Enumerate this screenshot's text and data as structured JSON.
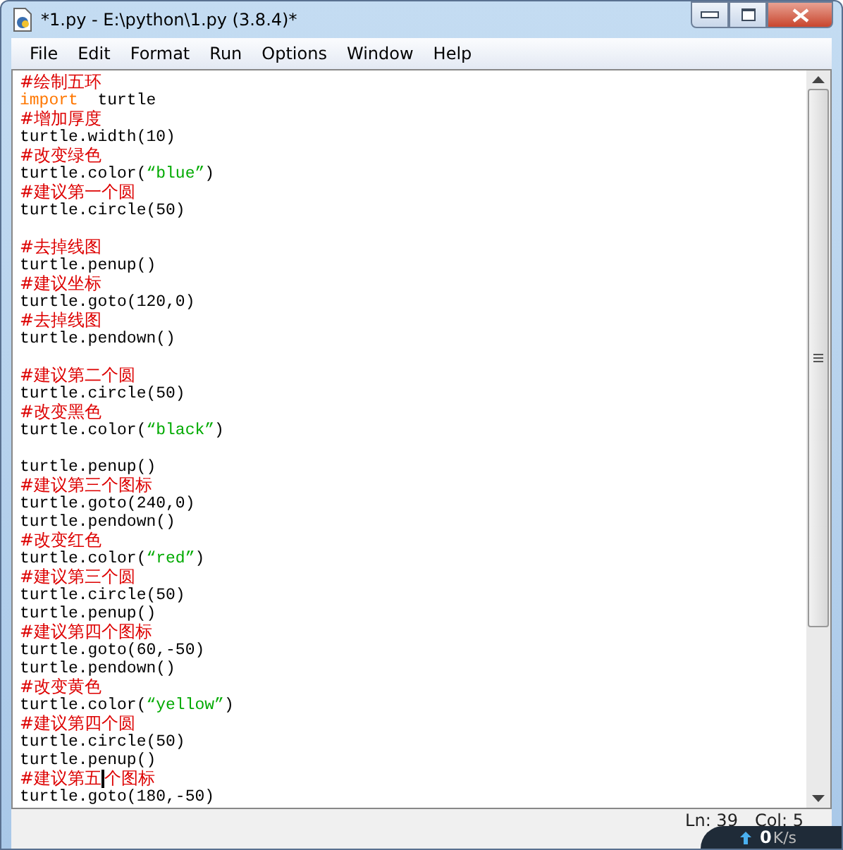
{
  "window": {
    "title": "*1.py - E:\\python\\1.py (3.8.4)*"
  },
  "menu": [
    "File",
    "Edit",
    "Format",
    "Run",
    "Options",
    "Window",
    "Help"
  ],
  "lines": [
    {
      "kind": "code",
      "tokens": [
        {
          "kind": "comment",
          "text": "#绘制五环"
        }
      ]
    },
    {
      "kind": "code",
      "tokens": [
        {
          "kind": "keyword",
          "text": "import"
        },
        {
          "kind": "plain",
          "text": "  turtle"
        }
      ]
    },
    {
      "kind": "code",
      "tokens": [
        {
          "kind": "comment",
          "text": "#增加厚度"
        }
      ]
    },
    {
      "kind": "code",
      "tokens": [
        {
          "kind": "plain",
          "text": "turtle.width(10)"
        }
      ]
    },
    {
      "kind": "code",
      "tokens": [
        {
          "kind": "comment",
          "text": "#改变绿色"
        }
      ]
    },
    {
      "kind": "code",
      "tokens": [
        {
          "kind": "plain",
          "text": "turtle.color("
        },
        {
          "kind": "string",
          "text": "“blue”"
        },
        {
          "kind": "plain",
          "text": ")"
        }
      ]
    },
    {
      "kind": "code",
      "tokens": [
        {
          "kind": "comment",
          "text": "#建议第一个圆"
        }
      ]
    },
    {
      "kind": "code",
      "tokens": [
        {
          "kind": "plain",
          "text": "turtle.circle(50)"
        }
      ]
    },
    {
      "kind": "blank"
    },
    {
      "kind": "code",
      "tokens": [
        {
          "kind": "comment",
          "text": "#去掉线图"
        }
      ]
    },
    {
      "kind": "code",
      "tokens": [
        {
          "kind": "plain",
          "text": "turtle.penup()"
        }
      ]
    },
    {
      "kind": "code",
      "tokens": [
        {
          "kind": "comment",
          "text": "#建议坐标"
        }
      ]
    },
    {
      "kind": "code",
      "tokens": [
        {
          "kind": "plain",
          "text": "turtle.goto(120,0)"
        }
      ]
    },
    {
      "kind": "code",
      "tokens": [
        {
          "kind": "comment",
          "text": "#去掉线图"
        }
      ]
    },
    {
      "kind": "code",
      "tokens": [
        {
          "kind": "plain",
          "text": "turtle.pendown()"
        }
      ]
    },
    {
      "kind": "blank"
    },
    {
      "kind": "code",
      "tokens": [
        {
          "kind": "comment",
          "text": "#建议第二个圆"
        }
      ]
    },
    {
      "kind": "code",
      "tokens": [
        {
          "kind": "plain",
          "text": "turtle.circle(50)"
        }
      ]
    },
    {
      "kind": "code",
      "tokens": [
        {
          "kind": "comment",
          "text": "#改变黑色"
        }
      ]
    },
    {
      "kind": "code",
      "tokens": [
        {
          "kind": "plain",
          "text": "turtle.color("
        },
        {
          "kind": "string",
          "text": "“black”"
        },
        {
          "kind": "plain",
          "text": ")"
        }
      ]
    },
    {
      "kind": "blank"
    },
    {
      "kind": "code",
      "tokens": [
        {
          "kind": "plain",
          "text": "turtle.penup()"
        }
      ]
    },
    {
      "kind": "code",
      "tokens": [
        {
          "kind": "comment",
          "text": "#建议第三个图标"
        }
      ]
    },
    {
      "kind": "code",
      "tokens": [
        {
          "kind": "plain",
          "text": "turtle.goto(240,0)"
        }
      ]
    },
    {
      "kind": "code",
      "tokens": [
        {
          "kind": "plain",
          "text": "turtle.pendown()"
        }
      ]
    },
    {
      "kind": "code",
      "tokens": [
        {
          "kind": "comment",
          "text": "#改变红色"
        }
      ]
    },
    {
      "kind": "code",
      "tokens": [
        {
          "kind": "plain",
          "text": "turtle.color("
        },
        {
          "kind": "string",
          "text": "“red”"
        },
        {
          "kind": "plain",
          "text": ")"
        }
      ]
    },
    {
      "kind": "code",
      "tokens": [
        {
          "kind": "comment",
          "text": "#建议第三个圆"
        }
      ]
    },
    {
      "kind": "code",
      "tokens": [
        {
          "kind": "plain",
          "text": "turtle.circle(50)"
        }
      ]
    },
    {
      "kind": "code",
      "tokens": [
        {
          "kind": "plain",
          "text": "turtle.penup()"
        }
      ]
    },
    {
      "kind": "code",
      "tokens": [
        {
          "kind": "comment",
          "text": "#建议第四个图标"
        }
      ]
    },
    {
      "kind": "code",
      "tokens": [
        {
          "kind": "plain",
          "text": "turtle.goto(60,-50)"
        }
      ]
    },
    {
      "kind": "code",
      "tokens": [
        {
          "kind": "plain",
          "text": "turtle.pendown()"
        }
      ]
    },
    {
      "kind": "code",
      "tokens": [
        {
          "kind": "comment",
          "text": "#改变黄色"
        }
      ]
    },
    {
      "kind": "code",
      "tokens": [
        {
          "kind": "plain",
          "text": "turtle.color("
        },
        {
          "kind": "string",
          "text": "“yellow”"
        },
        {
          "kind": "plain",
          "text": ")"
        }
      ]
    },
    {
      "kind": "code",
      "tokens": [
        {
          "kind": "comment",
          "text": "#建议第四个圆"
        }
      ]
    },
    {
      "kind": "code",
      "tokens": [
        {
          "kind": "plain",
          "text": "turtle.circle(50)"
        }
      ]
    },
    {
      "kind": "code",
      "tokens": [
        {
          "kind": "plain",
          "text": "turtle.penup()"
        }
      ]
    },
    {
      "kind": "code",
      "tokens": [
        {
          "kind": "comment",
          "text": "#建议第五"
        },
        {
          "kind": "caret"
        },
        {
          "kind": "comment",
          "text": "个图标"
        }
      ]
    },
    {
      "kind": "code",
      "tokens": [
        {
          "kind": "plain",
          "text": "turtle.goto(180,-50)"
        }
      ]
    }
  ],
  "status_bar": {
    "line": "Ln: 39",
    "column": "Col: 5"
  },
  "net_speed": {
    "value": "0",
    "unit": "K/s"
  }
}
